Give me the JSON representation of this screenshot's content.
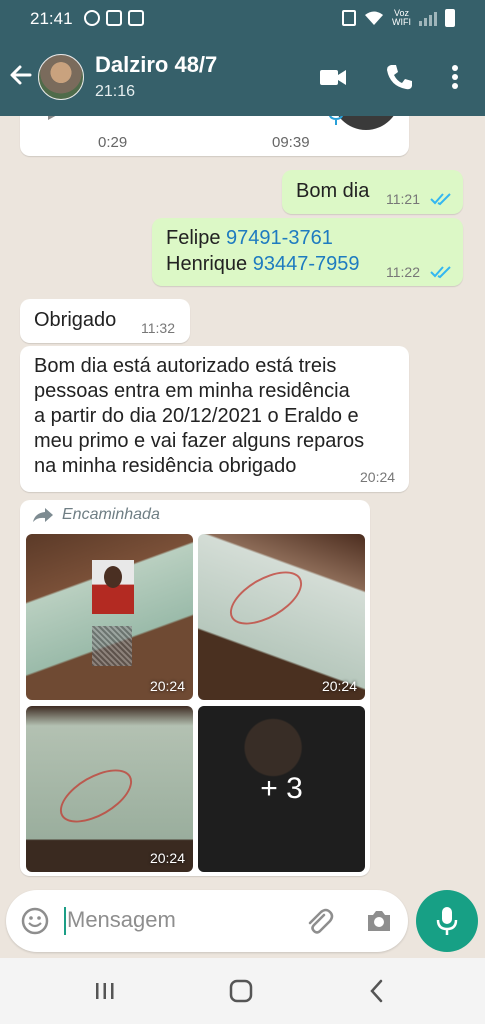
{
  "status_bar": {
    "time": "21:41",
    "network_label": "Voz\nWIFI",
    "notification_icons": [
      "whatsapp-icon",
      "gallery-icon",
      "app-icon"
    ]
  },
  "header": {
    "contact_name": "Dalziro 48/7",
    "subtitle": "21:16",
    "icons": [
      "back-arrow-icon",
      "video-call-icon",
      "phone-icon",
      "more-vert-icon"
    ],
    "color": "#36606a"
  },
  "voice_message": {
    "duration": "0:29",
    "time": "09:39"
  },
  "messages": [
    {
      "direction": "out",
      "text": "Bom dia",
      "time": "11:21",
      "status": "read"
    },
    {
      "direction": "out",
      "lines": [
        {
          "name": "Felipe",
          "phone": "97491-3761"
        },
        {
          "name": "Henrique",
          "phone": "93447-7959"
        }
      ],
      "time": "11:22",
      "status": "read"
    },
    {
      "direction": "in",
      "text": "Obrigado",
      "time": "11:32"
    },
    {
      "direction": "in",
      "lines": [
        "Bom dia está autorizado está treis",
        "pessoas entra em minha residência",
        "a partir do dia 20/12/2021 o Eraldo e",
        "meu primo e vai fazer alguns reparos",
        "na minha residência obrigado"
      ],
      "time": "20:24"
    }
  ],
  "forwarded": {
    "label": "Encaminhada",
    "images": [
      {
        "time": "20:24"
      },
      {
        "time": "20:24"
      },
      {
        "time": "20:24"
      },
      {
        "overlay": "+ 3"
      }
    ]
  },
  "composer": {
    "placeholder": "Mensagem"
  },
  "colors": {
    "outgoing_bubble": "#dcf8c6",
    "incoming_bubble": "#ffffff",
    "chat_background": "#ece5dd",
    "accent": "#17a085",
    "link": "#1e7bc0"
  }
}
